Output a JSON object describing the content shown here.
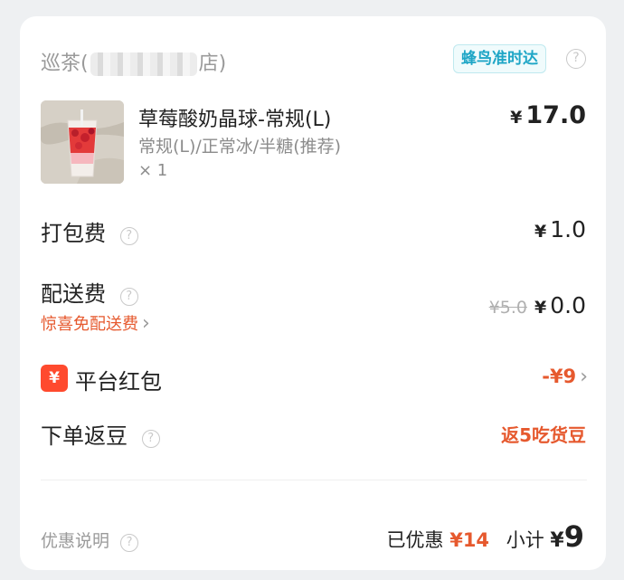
{
  "store": {
    "name_prefix": "巡茶(",
    "name_suffix": "店)",
    "badge": "蜂鸟准时达"
  },
  "item": {
    "name": "草莓酸奶晶球-常规(L)",
    "spec": "常规(L)/正常冰/半糖(推荐)",
    "qty": "× 1",
    "price": "17.0"
  },
  "fees": {
    "packing_label": "打包费",
    "packing_value": "1.0",
    "delivery_label": "配送费",
    "delivery_original": "¥5.0",
    "delivery_value": "0.0",
    "promo_text": "惊喜免配送费"
  },
  "redpacket": {
    "icon": "¥",
    "label": "平台红包",
    "value": "-¥9"
  },
  "beans": {
    "label": "下单返豆",
    "value": "返5吃货豆"
  },
  "footer": {
    "discount_note": "优惠说明",
    "saved_label": "已优惠",
    "saved_value": "¥14",
    "subtotal_label": "小计",
    "subtotal_yen": "¥",
    "subtotal_value": "9"
  },
  "yen": "¥",
  "colors": {
    "accent_orange": "#e6592e",
    "badge_blue": "#1fa6c6",
    "redpacket_red": "#ff4a2e"
  }
}
